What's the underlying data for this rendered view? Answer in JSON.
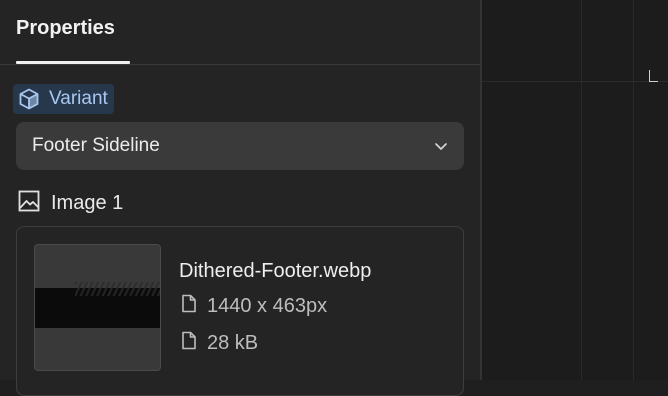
{
  "panel": {
    "tab_title": "Properties"
  },
  "variant": {
    "label": "Variant",
    "icon": "cube-icon",
    "selected_value": "Footer Sideline"
  },
  "image_section": {
    "title": "Image 1",
    "icon": "image-icon",
    "file": {
      "name": "Dithered-Footer.webp",
      "dimensions": "1440 x 463px",
      "size": "28 kB"
    }
  },
  "colors": {
    "panel_bg": "#242424",
    "accent_chip_bg": "#27384d",
    "accent_text": "#a9c8ef",
    "select_bg": "#3a3a3a"
  }
}
